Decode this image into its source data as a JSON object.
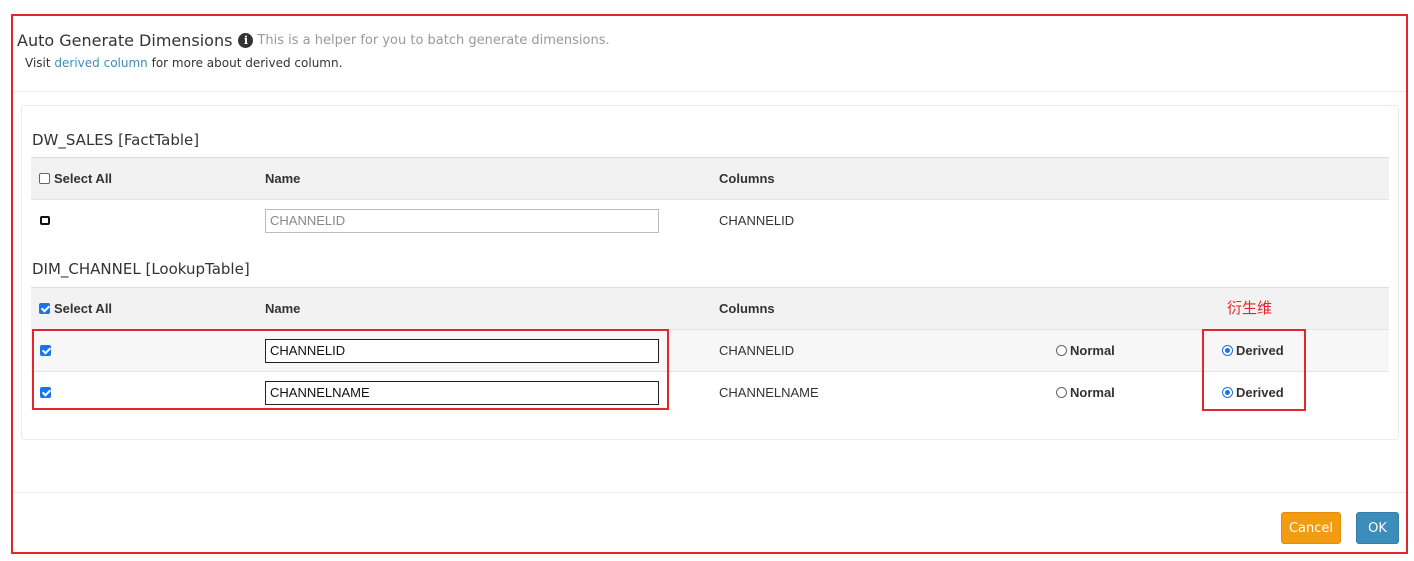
{
  "header": {
    "title": "Auto Generate Dimensions",
    "helper": "This is a helper for you to batch generate dimensions.",
    "visit_prefix": "Visit",
    "visit_link": "derived column",
    "visit_suffix": "for more about derived column."
  },
  "columns": {
    "select_all": "Select All",
    "name": "Name",
    "columns": "Columns"
  },
  "fact_table": {
    "title": "DW_SALES [FactTable]",
    "select_all_checked": false,
    "rows": [
      {
        "checked": false,
        "name": "CHANNELID",
        "column": "CHANNELID"
      }
    ]
  },
  "lookup_table": {
    "title": "DIM_CHANNEL [LookupTable]",
    "select_all_checked": true,
    "rows": [
      {
        "checked": true,
        "name": "CHANNELID",
        "column": "CHANNELID",
        "option_normal": "Normal",
        "option_derived": "Derived",
        "selected": "Derived"
      },
      {
        "checked": true,
        "name": "CHANNELNAME",
        "column": "CHANNELNAME",
        "option_normal": "Normal",
        "option_derived": "Derived",
        "selected": "Derived"
      }
    ]
  },
  "annotation": "衍生维",
  "footer": {
    "cancel_label": "Cancel",
    "ok_label": "OK"
  },
  "colors": {
    "annotation_red": "#e3262b",
    "link_blue": "#3c8dbc",
    "checkbox_blue": "#1a73e8",
    "cancel_orange": "#f39c12",
    "ok_blue": "#3c8dbc"
  }
}
